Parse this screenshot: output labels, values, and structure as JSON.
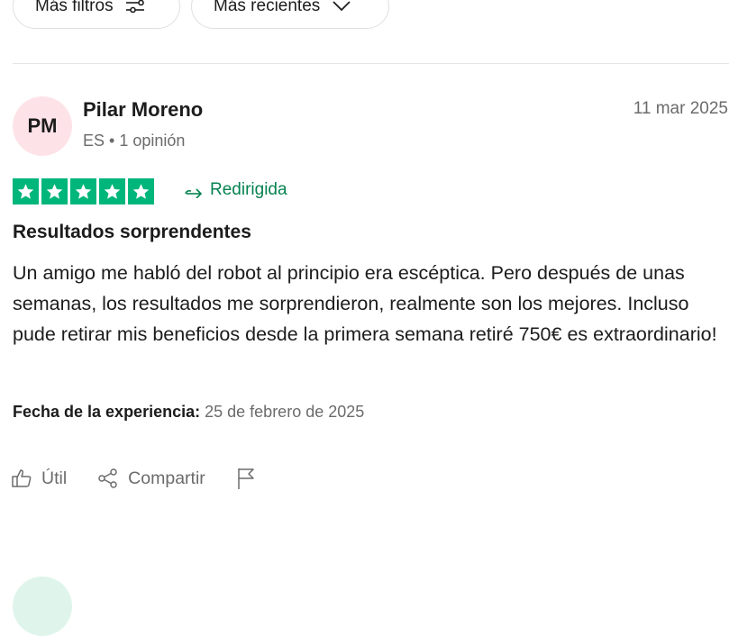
{
  "toolbar": {
    "filters_label": "Más filtros",
    "sort_label": "Más recientes"
  },
  "review": {
    "avatar_initials": "PM",
    "reviewer_name": "Pilar Moreno",
    "reviewer_meta": "ES • 1 opinión",
    "date": "11 mar 2025",
    "rating": 5,
    "rating_max": 5,
    "star_color": "#00b67a",
    "redirected_label": "Redirigida",
    "title": "Resultados sorprendentes",
    "body": "Un amigo me habló del robot al principio era escéptica. Pero después de unas semanas, los resultados me sorprendieron, realmente son los mejores. Incluso pude retirar mis beneficios desde la primera semana retiré 750€ es extraordinario!",
    "experience_label": "Fecha de la experiencia:",
    "experience_date": "25 de febrero de 2025",
    "actions": {
      "useful_label": "Útil",
      "share_label": "Compartir"
    }
  },
  "colors": {
    "accent_green": "#04824f",
    "avatar_bg": "#fde3e8",
    "next_avatar_bg": "#dff5ec"
  },
  "icons": [
    "sliders-icon",
    "chevron-down-icon",
    "star-icon",
    "redirect-arrow-icon",
    "thumbs-up-icon",
    "share-icon",
    "flag-icon"
  ]
}
